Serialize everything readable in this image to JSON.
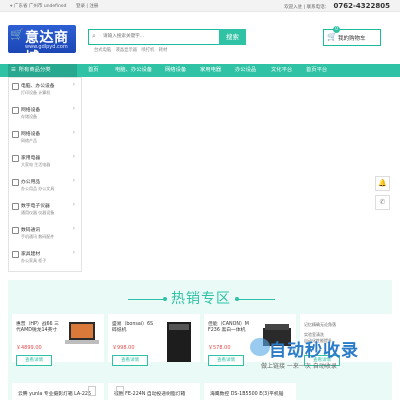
{
  "topbar": {
    "location": "广东省 广州市 undefined",
    "login": "登录",
    "register": "注册",
    "welcome": "欢迎入驻",
    "hotline_label": "联系电话：",
    "phone": "0762-4322805"
  },
  "logo": {
    "name": "意达商城",
    "url": "www.gdlpyd.com"
  },
  "search": {
    "placeholder": "请输入搜索关键字...",
    "button": "搜索",
    "hot_words": [
      "台式电脑",
      "液晶显示器",
      "喷打机",
      "耗材"
    ]
  },
  "cart": {
    "label": "我的购物车",
    "count": "0"
  },
  "nav": {
    "all_categories": "所有商品分类",
    "items": [
      "首页",
      "电脑、办公设备",
      "网络设备",
      "家用电器",
      "办公设品",
      "文化平台",
      "首页平台"
    ]
  },
  "sidebar": {
    "categories": [
      {
        "title": "电脑、办公设备",
        "sub": "打印设备    计算机"
      },
      {
        "title": "网络设备",
        "sub": "存储设备"
      },
      {
        "title": "网络设备",
        "sub": "网络产品"
      },
      {
        "title": "家用电器",
        "sub": "大家电    生活电器"
      },
      {
        "title": "办公用品",
        "sub": "办公用品    办公文具"
      },
      {
        "title": "数字电子仪器",
        "sub": "通用仪器    仪器设备"
      },
      {
        "title": "数码通讯",
        "sub": "手机通讯    数码配件"
      },
      {
        "title": "家具建材",
        "sub": "办公家具    柜子"
      }
    ]
  },
  "hot_section": {
    "title": "热销专区",
    "cards": [
      {
        "name": "惠普（HP）战66 三代AMD锐龙14英寸",
        "price": "￥4899.00",
        "button": "查看详情"
      },
      {
        "name": "盛易（bonsai）6S 碎纸机",
        "price": "￥998.00",
        "button": "查看详情"
      },
      {
        "name": "佳能（CANON）M F236 黑白一体机",
        "price": "￥578.00",
        "button": "查看详情"
      },
      {
        "name": "",
        "price": "",
        "button": "查看详情"
      }
    ],
    "cards_row2": [
      {
        "name": "云腾 yunla 专业摄影灯箱 LA-226"
      },
      {
        "name": "得胜 FE-224N 自动投递树脂灯箱"
      },
      {
        "name": "海鹰数控 DS-1B5500 E(3)平机锯"
      }
    ],
    "banner_text": [
      "记忆精确无论角落",
      "实验室清洗",
      "自动化性能提升"
    ]
  },
  "watermark": {
    "brand": "自动秒收录",
    "slogan": "做上链接 一来一次 自动收录"
  }
}
